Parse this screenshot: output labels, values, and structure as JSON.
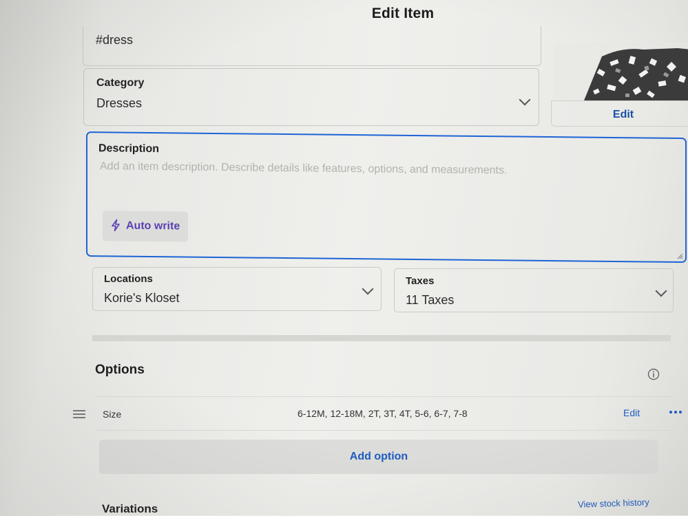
{
  "header": {
    "title": "Edit Item"
  },
  "tags": {
    "value": "#dress"
  },
  "category": {
    "label": "Category",
    "value": "Dresses"
  },
  "image": {
    "edit_label": "Edit"
  },
  "description": {
    "label": "Description",
    "placeholder": "Add an item description. Describe details like features, options, and measurements.",
    "auto_write_label": "Auto write"
  },
  "locations": {
    "label": "Locations",
    "value": "Korie's Kloset"
  },
  "taxes": {
    "label": "Taxes",
    "value": "11 Taxes"
  },
  "options": {
    "heading": "Options",
    "rows": [
      {
        "name": "Size",
        "values": "6-12M, 12-18M, 2T, 3T, 4T, 5-6, 6-7, 7-8",
        "edit_label": "Edit"
      }
    ],
    "add_label": "Add option"
  },
  "variations": {
    "heading": "Variations",
    "stock_history_label": "View stock history"
  },
  "colors": {
    "accent": "#1d63d6",
    "link": "#1d5bc0",
    "auto_write": "#5b3fb1"
  }
}
